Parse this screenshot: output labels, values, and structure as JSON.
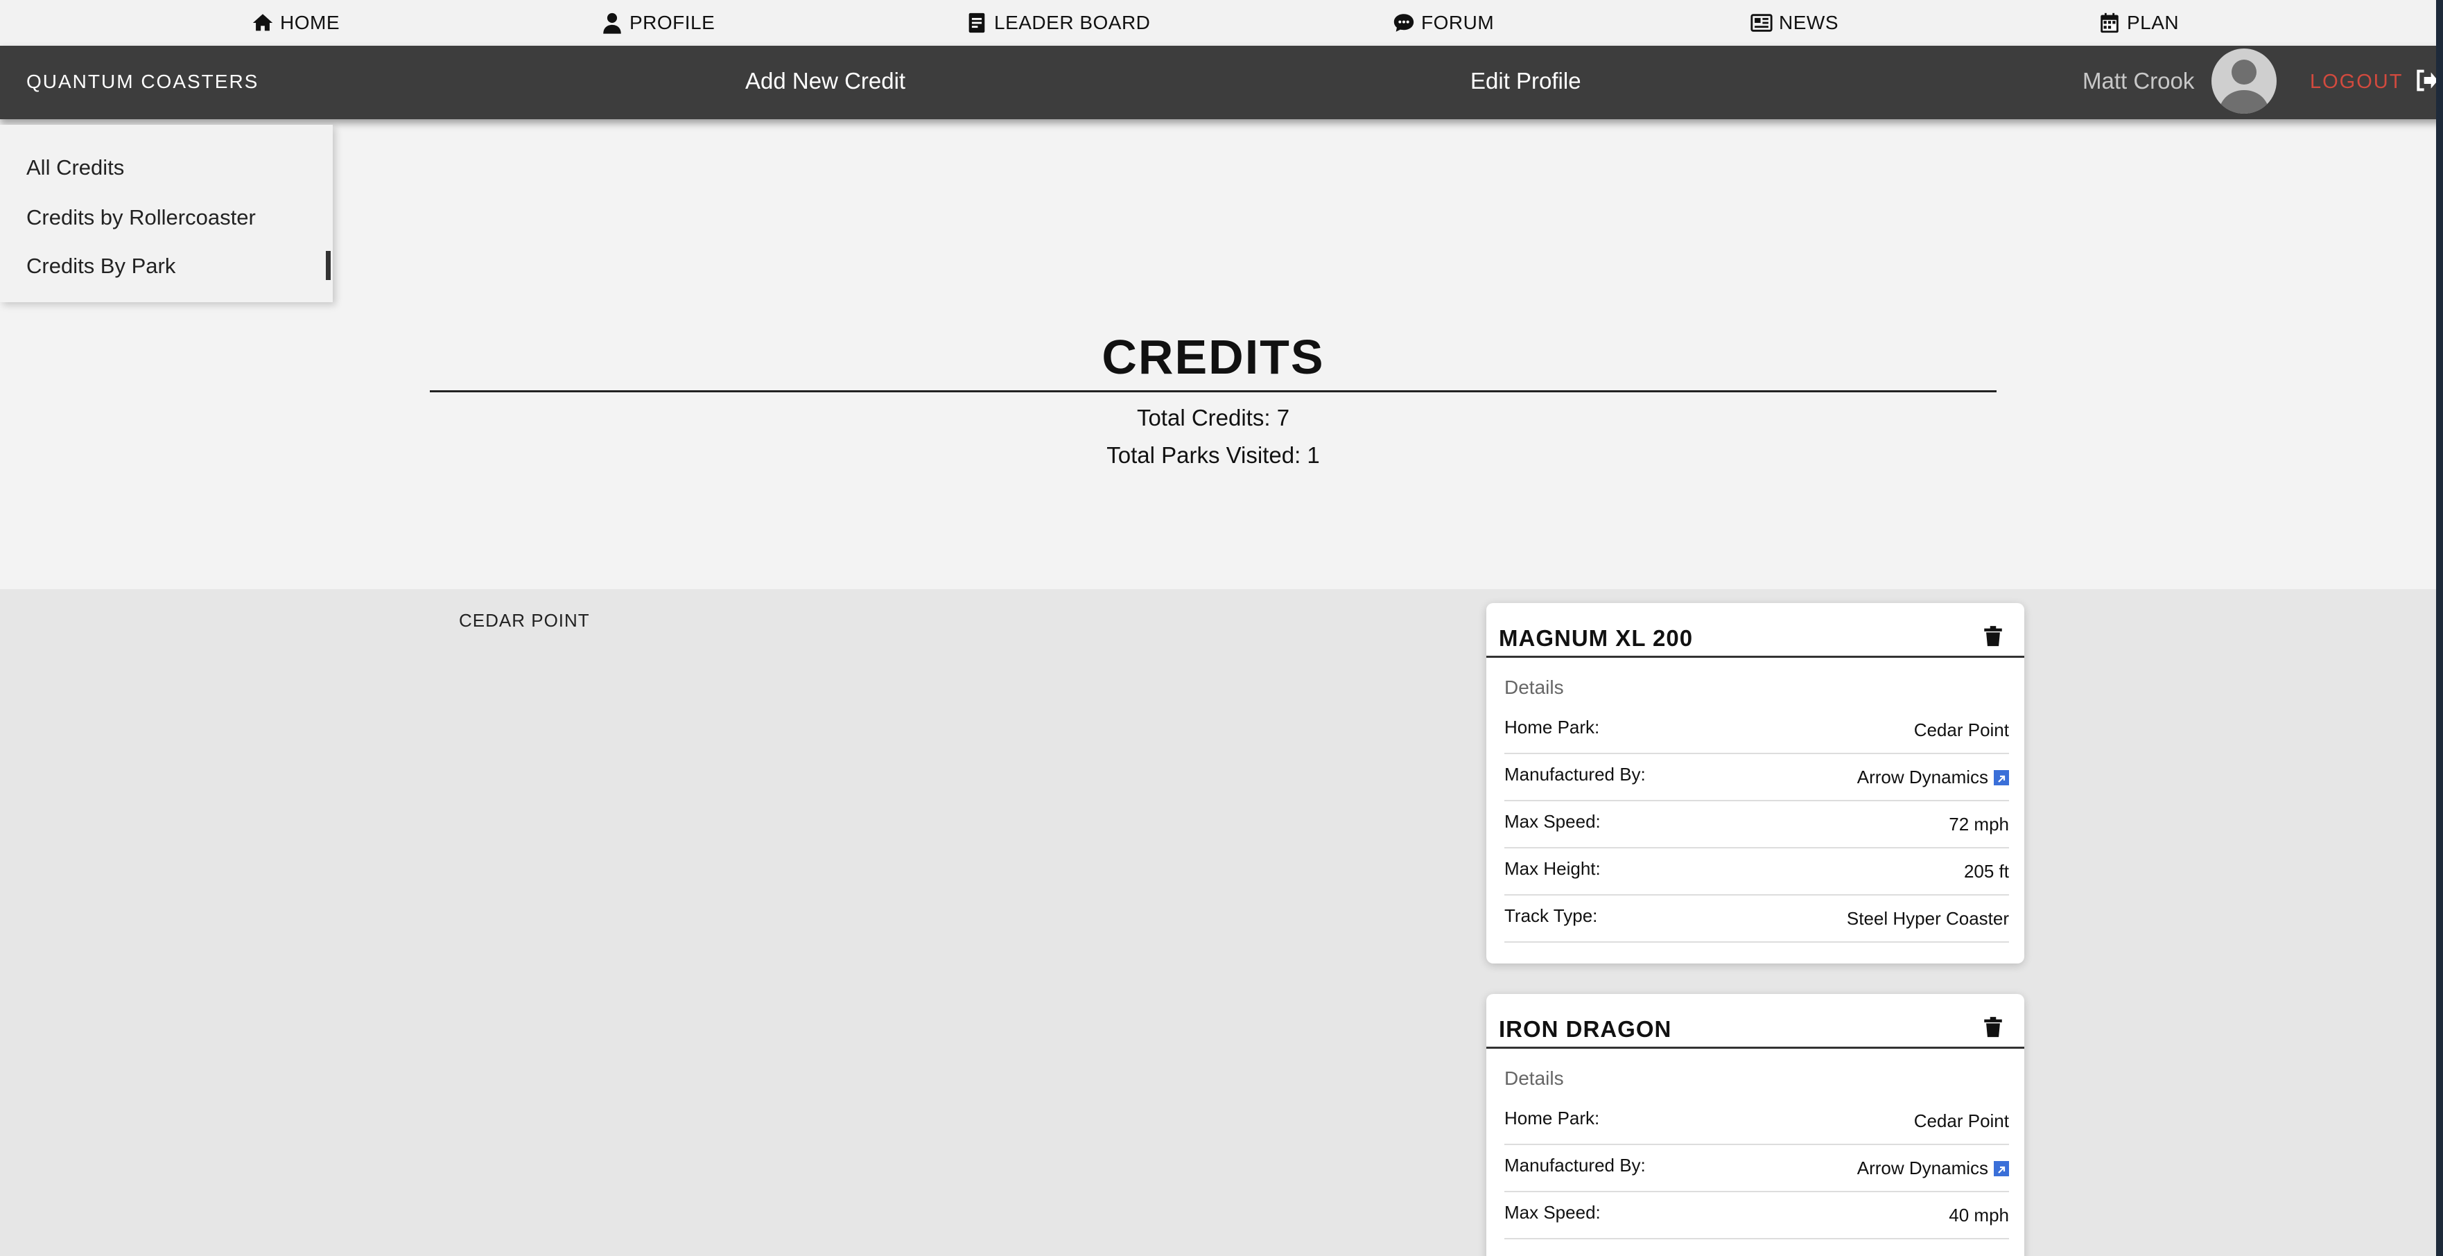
{
  "topnav": {
    "items": [
      {
        "label": "HOME",
        "icon": "home-icon"
      },
      {
        "label": "PROFILE",
        "icon": "user-icon"
      },
      {
        "label": "LEADER BOARD",
        "icon": "document-icon"
      },
      {
        "label": "FORUM",
        "icon": "chat-icon"
      },
      {
        "label": "NEWS",
        "icon": "newspaper-icon"
      },
      {
        "label": "PLAN",
        "icon": "calendar-icon"
      }
    ]
  },
  "header": {
    "brand": "QUANTUM COASTERS",
    "add_credit": "Add New Credit",
    "edit_profile": "Edit Profile",
    "username": "Matt Crook",
    "logout": "LOGOUT"
  },
  "sidebar": {
    "items": [
      {
        "label": "All Credits"
      },
      {
        "label": "Credits by Rollercoaster"
      },
      {
        "label": "Credits By Park",
        "active": true
      }
    ]
  },
  "main": {
    "title": "CREDITS",
    "total_credits": "Total Credits: 7",
    "total_parks": "Total Parks Visited: 1",
    "park_name": "CEDAR POINT"
  },
  "cards": [
    {
      "name": "MAGNUM XL 200",
      "details_label": "Details",
      "rows": [
        {
          "key": "Home Park:",
          "value": "Cedar Point"
        },
        {
          "key": "Manufactured By:",
          "value": "Arrow Dynamics",
          "link": true
        },
        {
          "key": "Max Speed:",
          "value": "72 mph"
        },
        {
          "key": "Max Height:",
          "value": "205 ft"
        },
        {
          "key": "Track Type:",
          "value": "Steel Hyper Coaster"
        }
      ]
    },
    {
      "name": "IRON DRAGON",
      "details_label": "Details",
      "rows": [
        {
          "key": "Home Park:",
          "value": "Cedar Point"
        },
        {
          "key": "Manufactured By:",
          "value": "Arrow Dynamics",
          "link": true
        },
        {
          "key": "Max Speed:",
          "value": "40 mph"
        }
      ]
    }
  ],
  "colors": {
    "header_bg": "#3d3d3d",
    "logout": "#d24a3e",
    "link_icon": "#3a6fd8"
  }
}
